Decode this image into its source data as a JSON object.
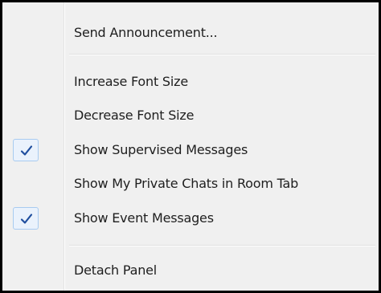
{
  "menu": {
    "items": [
      {
        "label": "Send Announcement...",
        "checked": false
      },
      {
        "label": "Increase Font Size",
        "checked": false
      },
      {
        "label": "Decrease Font Size",
        "checked": false
      },
      {
        "label": "Show Supervised Messages",
        "checked": true
      },
      {
        "label": "Show My Private Chats in Room Tab",
        "checked": false
      },
      {
        "label": "Show Event Messages",
        "checked": true
      },
      {
        "label": "Detach Panel",
        "checked": false
      }
    ],
    "check_icon": "checkmark-icon",
    "colors": {
      "border": "#000000",
      "background": "#f0f0f0",
      "check": "#1f4e9e",
      "check_bg": "#eaf2fc",
      "check_border": "#a8cbf0"
    }
  }
}
